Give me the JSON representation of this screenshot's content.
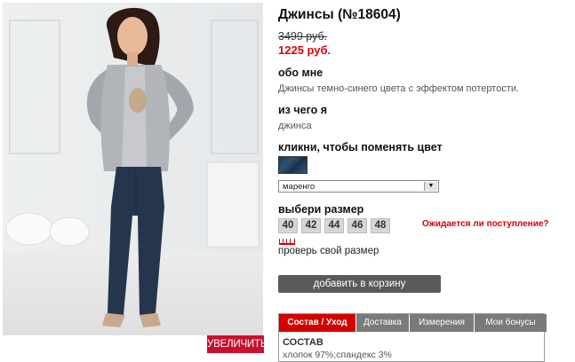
{
  "photo": {
    "zoom_label": "УВЕЛИЧИТЬ"
  },
  "product": {
    "title": "Джинсы (№18604)",
    "old_price": "3499 руб.",
    "new_price": "1225 руб."
  },
  "about": {
    "heading": "обо мне",
    "text": "Джинсы темно-синего цвета с эффектом потертости."
  },
  "material": {
    "heading": "из чего я",
    "text": "джинса"
  },
  "color": {
    "heading": "кликни, чтобы поменять цвет",
    "selected": "маренго",
    "swatch_color": "#1b3a55"
  },
  "size": {
    "heading": "выбери размер",
    "options": [
      "40",
      "42",
      "44",
      "46",
      "48"
    ],
    "notify_link": "Ожидается ли поступление?",
    "check_link": "проверь свой размер"
  },
  "cart": {
    "button_label": "добавить в корзину"
  },
  "tabs": {
    "items": [
      {
        "label": "Состав / Уход",
        "active": true
      },
      {
        "label": "Доставка",
        "active": false
      },
      {
        "label": "Измерения",
        "active": false
      },
      {
        "label": "Мои бонусы",
        "active": false
      }
    ],
    "content_heading": "СОСТАВ",
    "content_text": "хлопок 97%;спандекс 3%"
  },
  "colors": {
    "accent_red": "#d40000",
    "button_gray": "#5a5a5a"
  }
}
